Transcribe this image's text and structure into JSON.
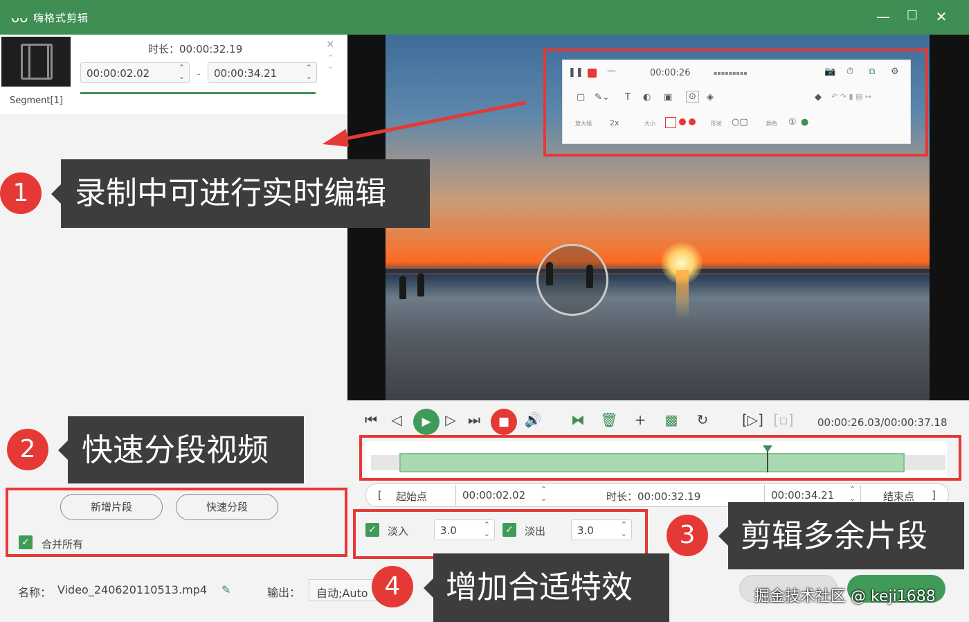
{
  "app": {
    "title": "嗨格式剪辑",
    "logo_icon": "rabbit-logo-icon"
  },
  "window_controls": {
    "minimize": "—",
    "maximize": "☐",
    "close": "✕"
  },
  "segment_panel": {
    "segment_label": "Segment[1]",
    "duration_label": "时长：",
    "duration_value": "00:00:32.19",
    "start_time": "00:00:02.02",
    "end_time": "00:00:34.21",
    "separator": "-"
  },
  "recording_toolbar": {
    "timer": "00:00:26",
    "row3_labels": [
      "放大镜",
      "2x",
      "大小",
      "形状",
      "颜色"
    ]
  },
  "playback": {
    "time_readout": "00:00:26.03/00:00:37.18",
    "playhead_fraction": 0.73
  },
  "trim": {
    "start_btn": "起始点",
    "start_value": "00:00:02.02",
    "duration_label": "时长：",
    "duration_value": "00:00:32.19",
    "end_value": "00:00:34.21",
    "end_btn": "结束点",
    "bracket_left": "[",
    "bracket_right": "]"
  },
  "effects": {
    "fade_in_label": "淡入",
    "fade_in_value": "3.0",
    "fade_out_label": "淡出",
    "fade_out_value": "3.0"
  },
  "segment_actions": {
    "new_segment": "新增片段",
    "quick_split": "快速分段",
    "merge_all": "合并所有"
  },
  "footer": {
    "name_label": "名称：",
    "file_name": "Video_240620110513.mp4",
    "output_label": "输出：",
    "output_value": "自动;Auto"
  },
  "callouts": [
    {
      "num": "1",
      "text": "录制中可进行实时编辑"
    },
    {
      "num": "2",
      "text": "快速分段视频"
    },
    {
      "num": "3",
      "text": "剪辑多余片段"
    },
    {
      "num": "4",
      "text": "增加合适特效"
    }
  ],
  "watermark": "掘金技术社区 @ keji1688",
  "colors": {
    "accent": "#3f8e53",
    "highlight": "#e53935",
    "callout_bg": "#3d3d3d"
  }
}
